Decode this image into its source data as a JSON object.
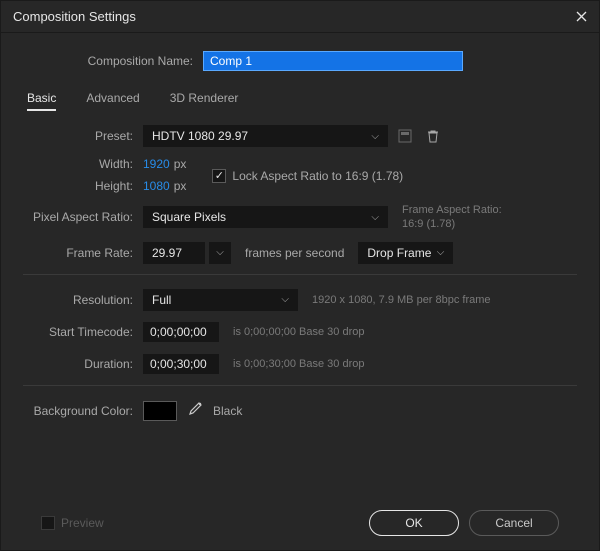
{
  "titlebar": {
    "title": "Composition Settings"
  },
  "comp": {
    "name_label": "Composition Name:",
    "name_value": "Comp 1"
  },
  "tabs": {
    "basic": "Basic",
    "advanced": "Advanced",
    "renderer": "3D Renderer"
  },
  "preset": {
    "label": "Preset:",
    "value": "HDTV 1080 29.97"
  },
  "width": {
    "label": "Width:",
    "value": "1920",
    "unit": "px"
  },
  "height": {
    "label": "Height:",
    "value": "1080",
    "unit": "px"
  },
  "lock_aspect": {
    "label": "Lock Aspect Ratio to 16:9 (1.78)"
  },
  "par": {
    "label": "Pixel Aspect Ratio:",
    "value": "Square Pixels"
  },
  "far": {
    "label": "Frame Aspect Ratio:",
    "value": "16:9 (1.78)"
  },
  "fps": {
    "label": "Frame Rate:",
    "value": "29.97",
    "unit": "frames per second",
    "drop": "Drop Frame"
  },
  "resolution": {
    "label": "Resolution:",
    "value": "Full",
    "info": "1920 x 1080, 7.9 MB per 8bpc frame"
  },
  "start_tc": {
    "label": "Start Timecode:",
    "value": "0;00;00;00",
    "info": "is 0;00;00;00  Base 30  drop"
  },
  "duration": {
    "label": "Duration:",
    "value": "0;00;30;00",
    "info": "is 0;00;30;00  Base 30  drop"
  },
  "bgcolor": {
    "label": "Background Color:",
    "name": "Black",
    "hex": "#000000"
  },
  "footer": {
    "preview": "Preview",
    "ok": "OK",
    "cancel": "Cancel"
  }
}
